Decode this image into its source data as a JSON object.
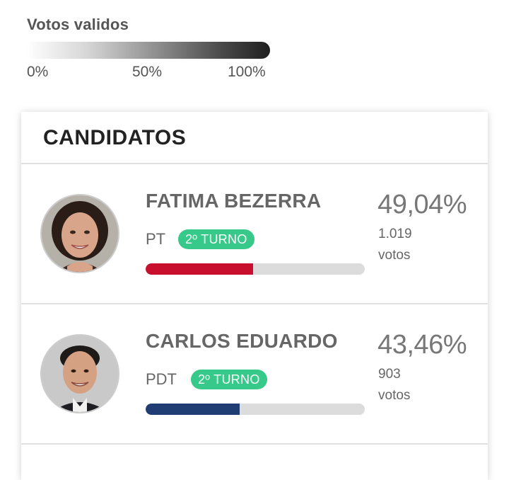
{
  "legend": {
    "title": "Votos validos",
    "ticks": [
      "0%",
      "50%",
      "100%"
    ]
  },
  "card": {
    "title": "CANDIDATOS"
  },
  "candidates": [
    {
      "name": "FATIMA BEZERRA",
      "party": "PT",
      "badge": "2º TURNO",
      "percent": "49,04%",
      "votes": "1.019",
      "votes_label": "votos",
      "bar_fraction": 0.49,
      "bar_color": "#c8102e",
      "avatar_icon": "woman-portrait-icon"
    },
    {
      "name": "CARLOS EDUARDO",
      "party": "PDT",
      "badge": "2º TURNO",
      "percent": "43,46%",
      "votes": "903",
      "votes_label": "votos",
      "bar_fraction": 0.43,
      "bar_color": "#1f3d73",
      "avatar_icon": "man-portrait-icon"
    }
  ],
  "colors": {
    "badge": "#37c98a",
    "bar_track": "#dcdcdc"
  }
}
